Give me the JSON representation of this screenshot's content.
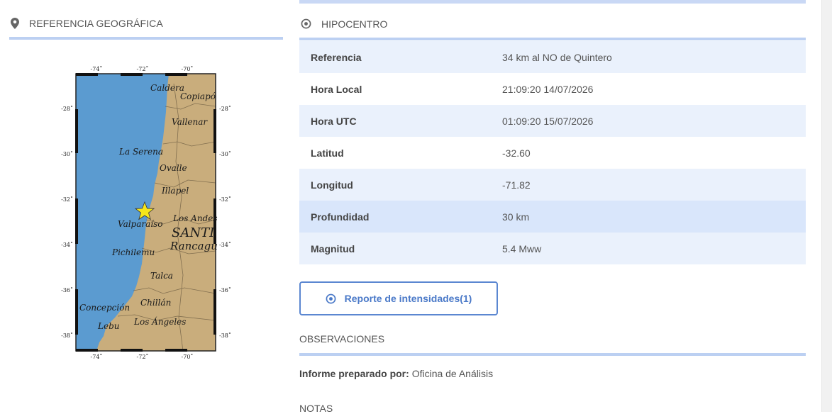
{
  "left_panel": {
    "title": "REFERENCIA GEOGRÁFICA",
    "map": {
      "top_ticks": [
        "-74˚",
        "-72˚",
        "-70˚"
      ],
      "bottom_ticks": [
        "-74˚",
        "-72˚",
        "-70˚"
      ],
      "left_ticks": [
        "-28˚",
        "-30˚",
        "-32˚",
        "-34˚",
        "-36˚",
        "-38˚"
      ],
      "right_ticks": [
        "-28˚",
        "-30˚",
        "-32˚",
        "-34˚",
        "-36˚",
        "-38˚"
      ],
      "cities": [
        "Caldera",
        "Copiapó",
        "Vallenar",
        "La Serena",
        "Ovalle",
        "Illapel",
        "Los Andes",
        "Valparaíso",
        "SANTI",
        "Rancagu",
        "Pichilemu",
        "Talca",
        "Chillán",
        "Concepción",
        "Lebu",
        "Los Ángeles"
      ],
      "epicenter_marker": "star-icon",
      "colors": {
        "ocean": "#5b9bd0",
        "land": "#c9ad7c",
        "star": "#f5e61a"
      }
    }
  },
  "right_panel": {
    "title": "HIPOCENTRO",
    "rows": [
      {
        "key": "Referencia",
        "value": "34 km al NO de Quintero"
      },
      {
        "key": "Hora Local",
        "value": "21:09:20 14/07/2026"
      },
      {
        "key": "Hora UTC",
        "value": "01:09:20 15/07/2026"
      },
      {
        "key": "Latitud",
        "value": "-32.60"
      },
      {
        "key": "Longitud",
        "value": "-71.82"
      },
      {
        "key": "Profundidad",
        "value": "30 km"
      },
      {
        "key": "Magnitud",
        "value": "5.4 Mww"
      }
    ],
    "report_button": "Reporte de intensidades(1)",
    "observations_title": "OBSERVACIONES",
    "informe_label": "Informe preparado por:",
    "informe_value": "Oficina de Análisis",
    "notas_title": "NOTAS"
  },
  "colors": {
    "accent": "#5b87d1",
    "header_border": "#bcd0f2",
    "row_stripe": "#eaf1fc",
    "row_highlight": "#d9e6fb"
  }
}
